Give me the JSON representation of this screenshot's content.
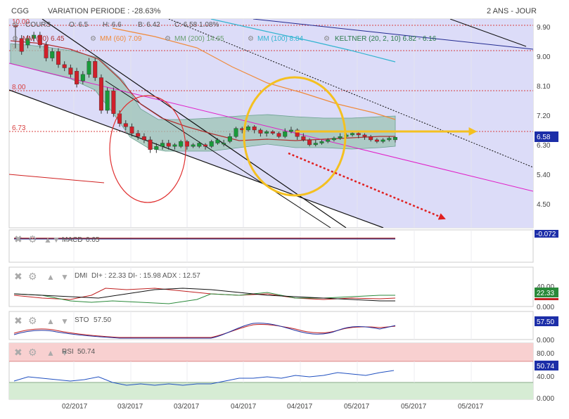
{
  "header": {
    "symbol": "CGG",
    "variation": "VARIATION PERIODE : -28.63%",
    "period": "2 ANS - JOUR"
  },
  "legend": {
    "cours": "COURS",
    "ohlc": "O: 6.5",
    "high": "H: 6.6",
    "low": "B: 6.42",
    "close": "C: 6.58 1.08%",
    "mm20": "MM (20) 6.45",
    "mm60": "MM (60) 7.09",
    "mm200": "MM (200) 14.65",
    "mm100": "MM (100) 8.84",
    "keltner": "KELTNER (20, 2, 10) 6.82 - 6.16"
  },
  "colors": {
    "up": "#1a9a3a",
    "down": "#d0202a",
    "mm20": "#b03030",
    "mm60": "#f08a3a",
    "mm100": "#32b4d0",
    "mm200": "#6aa070",
    "keltner_fill": "#9cc4b4",
    "bg_band": "#dcdcf8",
    "highlight": "#f4c020",
    "forecast": "#e02020",
    "channel": "#e020c8",
    "price_tag": "#1c2ea8",
    "dmi_tag": "#2a8a3a",
    "sto_tag": "#1c2ea8",
    "rsi_tag": "#1c2ea8"
  },
  "price_axis": {
    "ticks": [
      "9.90",
      "9.00",
      "8.10",
      "7.20",
      "6.30",
      "5.40",
      "4.50"
    ],
    "last_price": "6.58",
    "levels": [
      "10.00",
      "9.",
      "8.00",
      "6.73"
    ]
  },
  "x_axis": {
    "ticks": [
      "02/2017",
      "03/2017",
      "03/2017",
      "04/2017",
      "04/2017",
      "05/2017",
      "05/2017",
      "05/2017"
    ]
  },
  "macd": {
    "label": "MACD",
    "value": "0.05",
    "tag": "-0.072"
  },
  "dmi": {
    "label": "DMI",
    "values": "DI+ : 22.33 DI- : 15.98 ADX : 12.57",
    "tag": "22.33",
    "ticks": [
      "40.00",
      "0.000"
    ]
  },
  "sto": {
    "label": "STO",
    "value": "57.50",
    "tag": "57.50",
    "ticks": [
      "0.000"
    ]
  },
  "rsi": {
    "label": "RSI",
    "value": "50.74",
    "tag": "50.74",
    "ticks": [
      "80.00",
      "40.00",
      "0.000"
    ]
  },
  "chart_data": {
    "type": "candlestick",
    "title": "CGG",
    "period": "2 ANS - JOUR",
    "ylim": [
      3.9,
      10.3
    ],
    "x_ticks": [
      "02/2017",
      "03/2017",
      "03/2017",
      "04/2017",
      "04/2017",
      "05/2017",
      "05/2017",
      "05/2017"
    ],
    "candles": [
      [
        10.0,
        9.95,
        10.0,
        9.3
      ],
      [
        9.6,
        9.2,
        9.7,
        9.1
      ],
      [
        9.4,
        9.6,
        9.7,
        9.3
      ],
      [
        9.6,
        9.7,
        9.8,
        9.5
      ],
      [
        9.7,
        9.4,
        9.8,
        9.3
      ],
      [
        9.4,
        9.0,
        9.5,
        8.9
      ],
      [
        9.0,
        9.2,
        9.3,
        8.9
      ],
      [
        9.2,
        8.8,
        9.3,
        8.7
      ],
      [
        8.8,
        8.7,
        8.9,
        8.6
      ],
      [
        8.7,
        8.5,
        8.8,
        8.4
      ],
      [
        8.6,
        8.2,
        8.7,
        8.1
      ],
      [
        8.3,
        8.5,
        8.6,
        8.2
      ],
      [
        8.5,
        8.9,
        9.0,
        8.4
      ],
      [
        8.9,
        8.4,
        9.0,
        8.3
      ],
      [
        8.4,
        7.4,
        8.5,
        7.3
      ],
      [
        7.4,
        8.0,
        8.1,
        7.3
      ],
      [
        8.0,
        7.3,
        8.1,
        7.2
      ],
      [
        7.3,
        7.0,
        7.4,
        6.9
      ],
      [
        7.0,
        6.9,
        7.1,
        6.8
      ],
      [
        6.9,
        6.7,
        7.0,
        6.6
      ],
      [
        6.7,
        6.6,
        6.8,
        6.5
      ],
      [
        6.6,
        6.5,
        6.7,
        6.4
      ],
      [
        6.5,
        6.2,
        6.6,
        6.1
      ],
      [
        6.2,
        6.3,
        6.4,
        6.1
      ],
      [
        6.3,
        6.4,
        6.5,
        6.2
      ],
      [
        6.4,
        6.3,
        6.5,
        6.2
      ],
      [
        6.3,
        6.35,
        6.4,
        6.2
      ],
      [
        6.3,
        6.45,
        6.5,
        6.25
      ],
      [
        6.45,
        6.3,
        6.5,
        6.2
      ],
      [
        6.3,
        6.35,
        6.4,
        6.25
      ],
      [
        6.3,
        6.4,
        6.45,
        6.25
      ],
      [
        6.35,
        6.3,
        6.4,
        6.2
      ],
      [
        6.3,
        6.45,
        6.5,
        6.25
      ],
      [
        6.4,
        6.5,
        6.55,
        6.35
      ],
      [
        6.4,
        6.4,
        6.5,
        6.3
      ],
      [
        6.45,
        6.6,
        6.7,
        6.4
      ],
      [
        6.6,
        6.85,
        6.9,
        6.55
      ],
      [
        6.85,
        6.8,
        6.9,
        6.7
      ],
      [
        6.8,
        6.9,
        6.95,
        6.75
      ],
      [
        6.9,
        6.8,
        6.95,
        6.7
      ],
      [
        6.8,
        6.7,
        6.85,
        6.6
      ],
      [
        6.7,
        6.75,
        6.8,
        6.6
      ],
      [
        6.75,
        6.7,
        6.8,
        6.65
      ],
      [
        6.7,
        6.6,
        6.75,
        6.55
      ],
      [
        6.6,
        6.75,
        6.85,
        6.55
      ],
      [
        6.75,
        6.8,
        6.9,
        6.7
      ],
      [
        6.8,
        6.6,
        6.85,
        6.5
      ],
      [
        6.6,
        6.5,
        6.7,
        6.45
      ],
      [
        6.5,
        6.35,
        6.55,
        6.3
      ],
      [
        6.35,
        6.4,
        6.5,
        6.3
      ],
      [
        6.4,
        6.45,
        6.5,
        6.35
      ],
      [
        6.45,
        6.5,
        6.55,
        6.4
      ],
      [
        6.5,
        6.55,
        6.6,
        6.45
      ],
      [
        6.55,
        6.6,
        6.7,
        6.5
      ],
      [
        6.6,
        6.65,
        6.7,
        6.55
      ],
      [
        6.65,
        6.7,
        6.75,
        6.6
      ],
      [
        6.7,
        6.65,
        6.75,
        6.55
      ],
      [
        6.65,
        6.6,
        6.7,
        6.5
      ],
      [
        6.6,
        6.5,
        6.65,
        6.45
      ],
      [
        6.5,
        6.45,
        6.55,
        6.4
      ],
      [
        6.45,
        6.5,
        6.55,
        6.4
      ],
      [
        6.5,
        6.55,
        6.6,
        6.45
      ],
      [
        6.5,
        6.58,
        6.6,
        6.42
      ]
    ]
  }
}
